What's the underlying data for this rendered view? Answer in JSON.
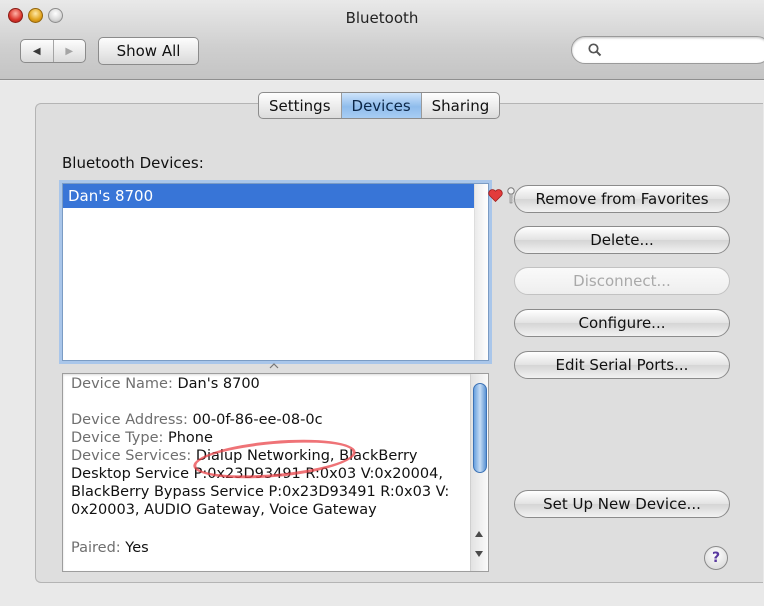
{
  "window": {
    "title": "Bluetooth"
  },
  "toolbar": {
    "back_icon": "back-arrow-icon",
    "forward_icon": "forward-arrow-icon",
    "show_all_label": "Show All",
    "search_icon": "search-icon",
    "search_value": ""
  },
  "tabs": [
    {
      "label": "Settings",
      "selected": false
    },
    {
      "label": "Devices",
      "selected": true
    },
    {
      "label": "Sharing",
      "selected": false
    }
  ],
  "devices": {
    "section_label": "Bluetooth Devices:",
    "items": [
      {
        "name": "Dan's 8700",
        "selected": true,
        "icons": [
          "heart-icon",
          "key-icon"
        ]
      }
    ]
  },
  "details": {
    "device_name_label": "Device Name:",
    "device_name": "Dan's 8700",
    "device_address_label": "Device Address:",
    "device_address": "00-0f-86-ee-08-0c",
    "device_type_label": "Device Type:",
    "device_type": "Phone",
    "device_services_label": "Device Services:",
    "service_highlighted": "Dialup Networking,",
    "services_rest_1": "BlackBerry",
    "services_line_2": "Desktop Service P:0x23D93491 R:0x03 V:0x20004,",
    "services_line_3": "BlackBerry Bypass Service P:0x23D93491 R:0x03 V:",
    "services_line_4": "0x20003, AUDIO Gateway, Voice Gateway",
    "paired_label": "Paired:",
    "paired": "Yes"
  },
  "buttons": {
    "remove_favorites": "Remove from Favorites",
    "delete": "Delete...",
    "disconnect": "Disconnect...",
    "configure": "Configure...",
    "edit_serial_ports": "Edit Serial Ports...",
    "set_up_new_device": "Set Up New Device...",
    "help": "?"
  },
  "colors": {
    "selection": "#3875d7",
    "tab_active": "#8fbcec",
    "annotation": "#e9444a"
  }
}
